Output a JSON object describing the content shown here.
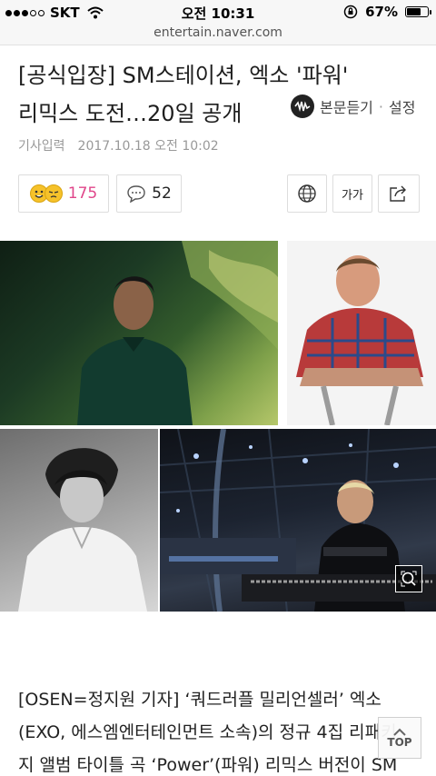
{
  "status_bar": {
    "carrier": "SKT",
    "time": "오전 10:31",
    "battery_percent": "67%",
    "battery_level": 0.67
  },
  "browser": {
    "url": "entertain.naver.com"
  },
  "article": {
    "title_line1": "[공식입장] SM스테이션, 엑소 '파워'",
    "title_line2": "리믹스 도전…20일 공개",
    "tts_label": "본문듣기",
    "settings_label": "설정",
    "date_label": "기사입력",
    "date": "2017.10.18 오전 10:02",
    "reaction_count": "175",
    "comment_count": "52",
    "font_size_label": "가가",
    "body_line1": "[OSEN=정지원 기자] ‘쿼드러플 밀리언셀러’ 엑소",
    "body_line2": "(EXO, 에스엠엔터테인먼트 소속)의 정규 4집 리패키",
    "body_line3": "지 앨범 타이틀 곡 ‘Power’(파워) 리믹스 버전이 SM"
  },
  "floating": {
    "top_label": "TOP"
  },
  "icons": {
    "tts": "speaker-icon",
    "reaction": "emoji-icon",
    "comment": "comment-icon",
    "globe": "globe-icon",
    "share": "share-icon",
    "zoom": "zoom-icon",
    "top_arrow": "chevron-up-icon"
  }
}
